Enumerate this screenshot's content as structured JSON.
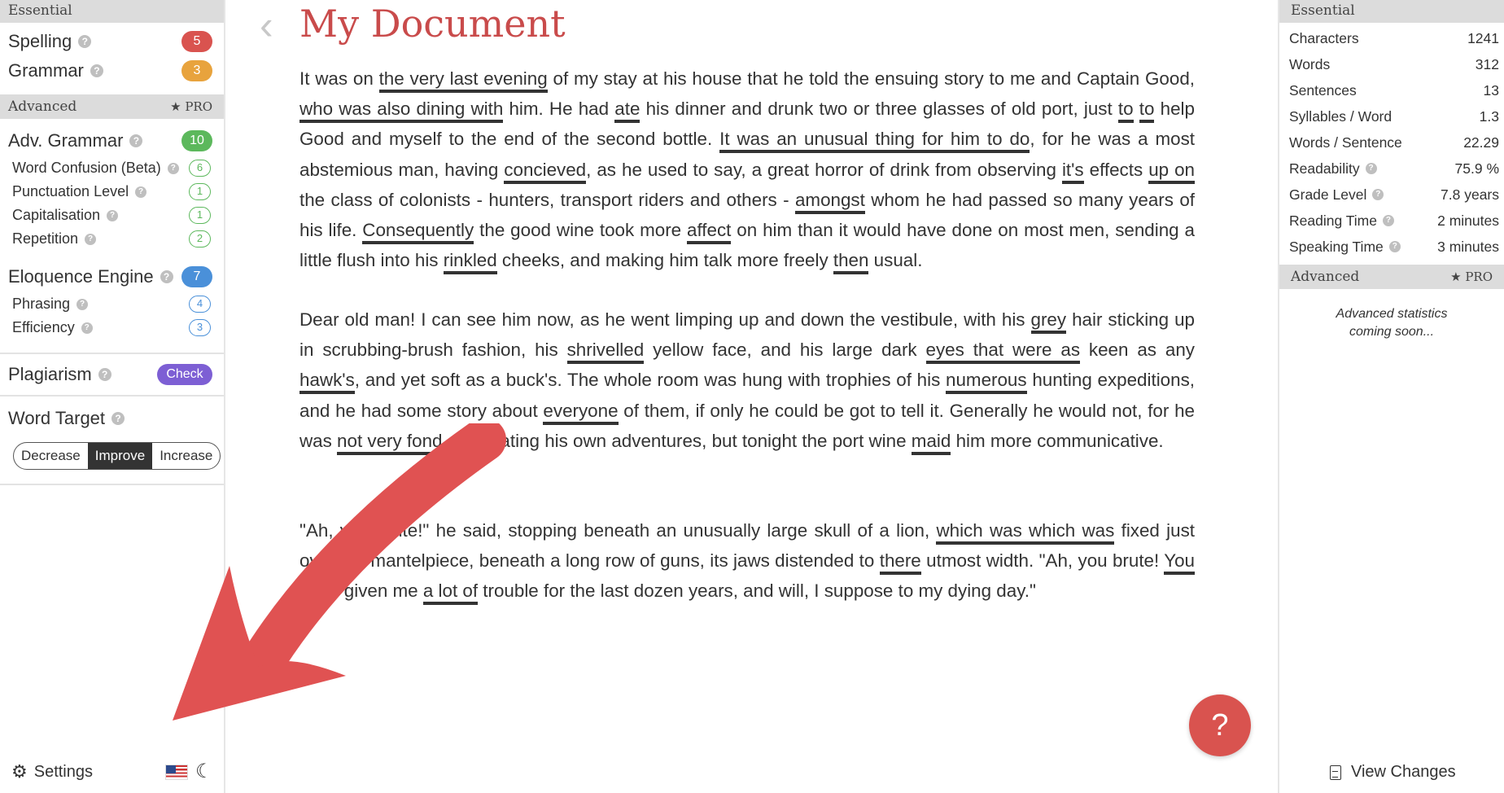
{
  "left": {
    "essential_header": "Essential",
    "spelling": {
      "label": "Spelling",
      "count": "5"
    },
    "grammar": {
      "label": "Grammar",
      "count": "3"
    },
    "advanced_header": "Advanced",
    "pro_label": "PRO",
    "adv_grammar": {
      "label": "Adv. Grammar",
      "count": "10"
    },
    "word_confusion": {
      "label": "Word Confusion (Beta)",
      "count": "6"
    },
    "punctuation": {
      "label": "Punctuation Level",
      "count": "1"
    },
    "capitalisation": {
      "label": "Capitalisation",
      "count": "1"
    },
    "repetition": {
      "label": "Repetition",
      "count": "2"
    },
    "eloquence": {
      "label": "Eloquence Engine",
      "count": "7"
    },
    "phrasing": {
      "label": "Phrasing",
      "count": "4"
    },
    "efficiency": {
      "label": "Efficiency",
      "count": "3"
    },
    "plagiarism": {
      "label": "Plagiarism",
      "button": "Check"
    },
    "word_target": {
      "label": "Word Target",
      "options": [
        "Decrease",
        "Improve",
        "Increase"
      ],
      "selected": "Improve"
    },
    "settings_label": "Settings"
  },
  "main": {
    "title": "My Document",
    "help_label": "?"
  },
  "right": {
    "essential_header": "Essential",
    "stats": [
      {
        "label": "Characters",
        "value": "1241"
      },
      {
        "label": "Words",
        "value": "312"
      },
      {
        "label": "Sentences",
        "value": "13"
      },
      {
        "label": "Syllables / Word",
        "value": "1.3"
      },
      {
        "label": "Words / Sentence",
        "value": "22.29"
      },
      {
        "label": "Readability",
        "value": "75.9 %"
      },
      {
        "label": "Grade Level",
        "value": "7.8 years"
      },
      {
        "label": "Reading Time",
        "value": "2 minutes"
      },
      {
        "label": "Speaking Time",
        "value": "3 minutes"
      }
    ],
    "advanced_header": "Advanced",
    "pro_label": "PRO",
    "soon_line1": "Advanced statistics",
    "soon_line2": "coming soon...",
    "view_changes": "View Changes"
  },
  "colors": {
    "spelling": "#cc3b3b",
    "grammar": "#e3a33a",
    "adv_grammar": "#5cba6e",
    "eloquence": "#3d86d6",
    "plagiarism": "#7d5fd4",
    "arrow": "#e05252"
  },
  "icons": [
    "help-question-icon",
    "star-icon",
    "gear-icon",
    "us-flag-icon",
    "moon-icon",
    "chevron-left-icon",
    "document-icon"
  ],
  "paragraphs": [
    [
      [
        "It was on ",
        ""
      ],
      [
        "the very last evening",
        "b"
      ],
      [
        " of my stay at his house that he told the ensuing story to me and Captain Good, ",
        ""
      ],
      [
        "who was also dining with",
        "b"
      ],
      [
        " him. He had ",
        ""
      ],
      [
        "ate",
        "o"
      ],
      [
        " his dinner and drunk two or three glasses of old port, just ",
        ""
      ],
      [
        "to",
        "g"
      ],
      [
        " ",
        ""
      ],
      [
        "to",
        "g"
      ],
      [
        " help Good and myself to the end of the second bottle. ",
        ""
      ],
      [
        "It was an unusual thing for him to do",
        "b"
      ],
      [
        ", for he was a most abstemious man, having ",
        ""
      ],
      [
        "concieved",
        "r"
      ],
      [
        ", as he used to say, a great horror of drink from observing ",
        ""
      ],
      [
        "it's",
        "o"
      ],
      [
        " effects ",
        ""
      ],
      [
        "up on",
        "g"
      ],
      [
        " the class of colonists - hunters, transport riders and others - ",
        ""
      ],
      [
        "amongst",
        "r"
      ],
      [
        " whom he had passed so many years of his life. ",
        ""
      ],
      [
        "Consequently",
        "g"
      ],
      [
        " the good wine took more ",
        ""
      ],
      [
        "affect",
        "g"
      ],
      [
        " on him than it would have done on most men, sending a little flush into his ",
        ""
      ],
      [
        "rinkled",
        "r"
      ],
      [
        " cheeks, and making him talk more freely ",
        ""
      ],
      [
        "then",
        "g"
      ],
      [
        " usual.",
        ""
      ]
    ],
    [
      [
        "Dear old man! I can see him now, as he went limping up and down the vestibule, with his ",
        ""
      ],
      [
        "grey",
        "r"
      ],
      [
        " hair sticking up in scrubbing-brush fashion, his ",
        ""
      ],
      [
        "shrivelled",
        "r"
      ],
      [
        " yellow face, and his large dark ",
        ""
      ],
      [
        "eyes that were as",
        "b"
      ],
      [
        " keen as any ",
        ""
      ],
      [
        "hawk's",
        "o"
      ],
      [
        ", and yet soft as a buck's. The whole room was hung with trophies of his ",
        ""
      ],
      [
        "numerous",
        "b"
      ],
      [
        " hunting expeditions, and he had some story about ",
        ""
      ],
      [
        "everyone",
        "g"
      ],
      [
        " of them, if only he could be got to tell it. Generally he would not, for he was ",
        ""
      ],
      [
        "not very fond",
        "b"
      ],
      [
        " of narrating his own adventures, but tonight the port wine ",
        ""
      ],
      [
        "maid",
        "g"
      ],
      [
        " him more communicative.",
        ""
      ]
    ],
    [
      [
        "\"Ah, you brute!\" he said, stopping beneath an unusually large skull of a lion, ",
        ""
      ],
      [
        "which was which was",
        "g"
      ],
      [
        " fixed just over the mantelpiece, beneath a long row of guns, its jaws distended to ",
        ""
      ],
      [
        "there",
        "g"
      ],
      [
        " utmost width. \"Ah, you brute! ",
        ""
      ],
      [
        "You",
        "g"
      ],
      [
        " have given me ",
        ""
      ],
      [
        "a lot of",
        "b"
      ],
      [
        " trouble for the last dozen years, and will, I suppose to my dying day.\"",
        ""
      ]
    ]
  ]
}
